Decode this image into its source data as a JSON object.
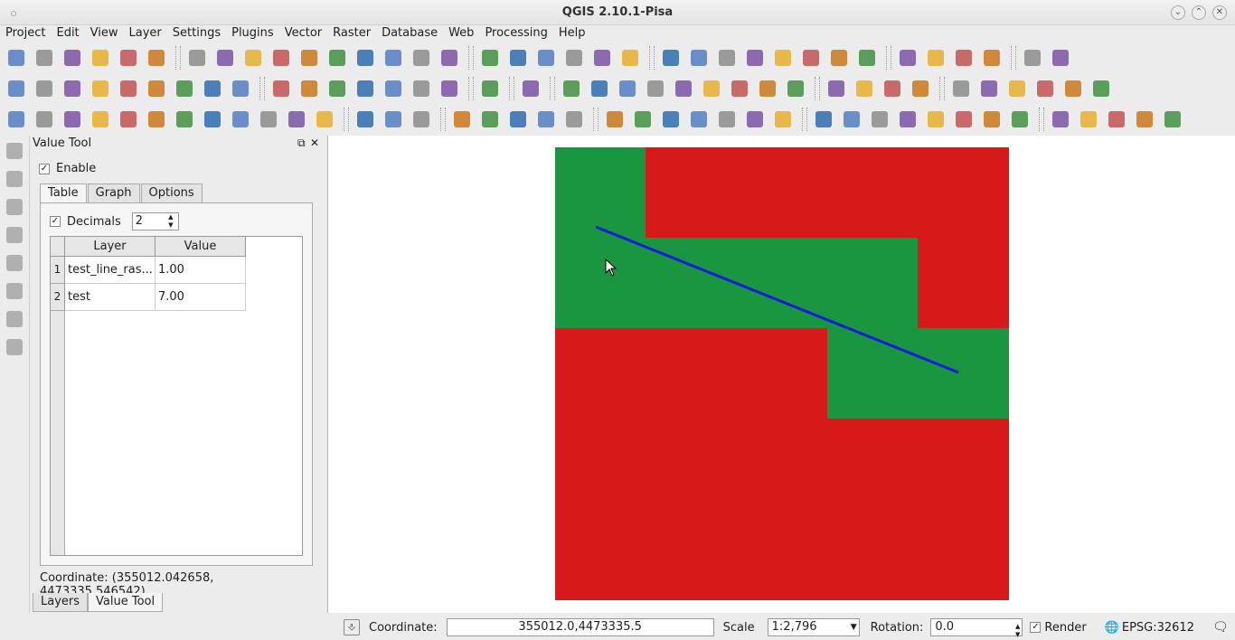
{
  "window": {
    "title": "QGIS 2.10.1-Pisa"
  },
  "menu": [
    "Project",
    "Edit",
    "View",
    "Layer",
    "Settings",
    "Plugins",
    "Vector",
    "Raster",
    "Database",
    "Web",
    "Processing",
    "Help"
  ],
  "dock": {
    "title": "Value Tool",
    "enable_label": "Enable",
    "enable_checked": true,
    "tabs": [
      "Table",
      "Graph",
      "Options"
    ],
    "active_tab": "Table",
    "decimals_label": "Decimals",
    "decimals_value": "2",
    "table": {
      "headers": [
        "Layer",
        "Value"
      ],
      "rows": [
        {
          "num": "1",
          "layer": "test_line_ras...",
          "value": "1.00"
        },
        {
          "num": "2",
          "layer": "test",
          "value": "7.00"
        }
      ]
    },
    "coordinate_text": "Coordinate: (355012.042658, 4473335.546542)",
    "bottom_tabs": [
      "Layers",
      "Value Tool"
    ]
  },
  "status": {
    "coordinate_label": "Coordinate:",
    "coordinate_value": "355012.0,4473335.5",
    "scale_label": "Scale",
    "scale_value": "1:2,796",
    "rotation_label": "Rotation:",
    "rotation_value": "0.0",
    "render_label": "Render",
    "crs": "EPSG:32612"
  },
  "map": {
    "colors": {
      "red": "#d7191c",
      "green": "#1a9641",
      "line": "#0a1edc"
    }
  }
}
